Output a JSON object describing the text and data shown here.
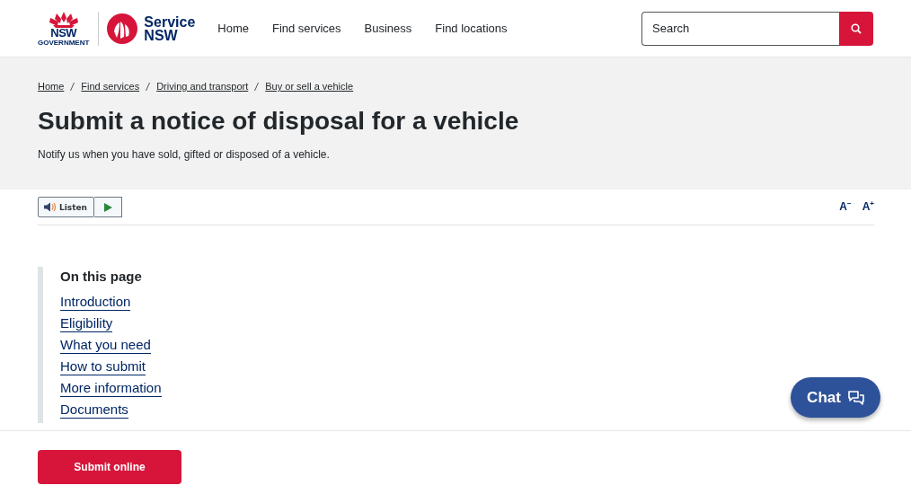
{
  "header": {
    "logo": {
      "line_1": "NSW",
      "line_2": "GOVERNMENT"
    },
    "brand": {
      "line_1": "Service",
      "line_2": "NSW"
    },
    "nav": [
      "Home",
      "Find services",
      "Business",
      "Find locations"
    ],
    "search": {
      "placeholder": "Search"
    }
  },
  "breadcrumbs": [
    "Home",
    "Find services",
    "Driving and transport",
    "Buy or sell a vehicle"
  ],
  "title": "Submit a notice of disposal for a vehicle",
  "intro": "Notify us when you have sold, gifted or disposed of a vehicle.",
  "listen": {
    "label": "Listen"
  },
  "text_size": [
    {
      "label": "A",
      "sign": "−"
    },
    {
      "label": "A",
      "sign": "+"
    }
  ],
  "on_this_page": {
    "heading": "On this page",
    "links": [
      "Introduction",
      "Eligibility",
      "What you need",
      "How to submit",
      "More information",
      "Documents"
    ]
  },
  "chat": {
    "label": "Chat"
  },
  "footer": {
    "button": "Submit online"
  }
}
